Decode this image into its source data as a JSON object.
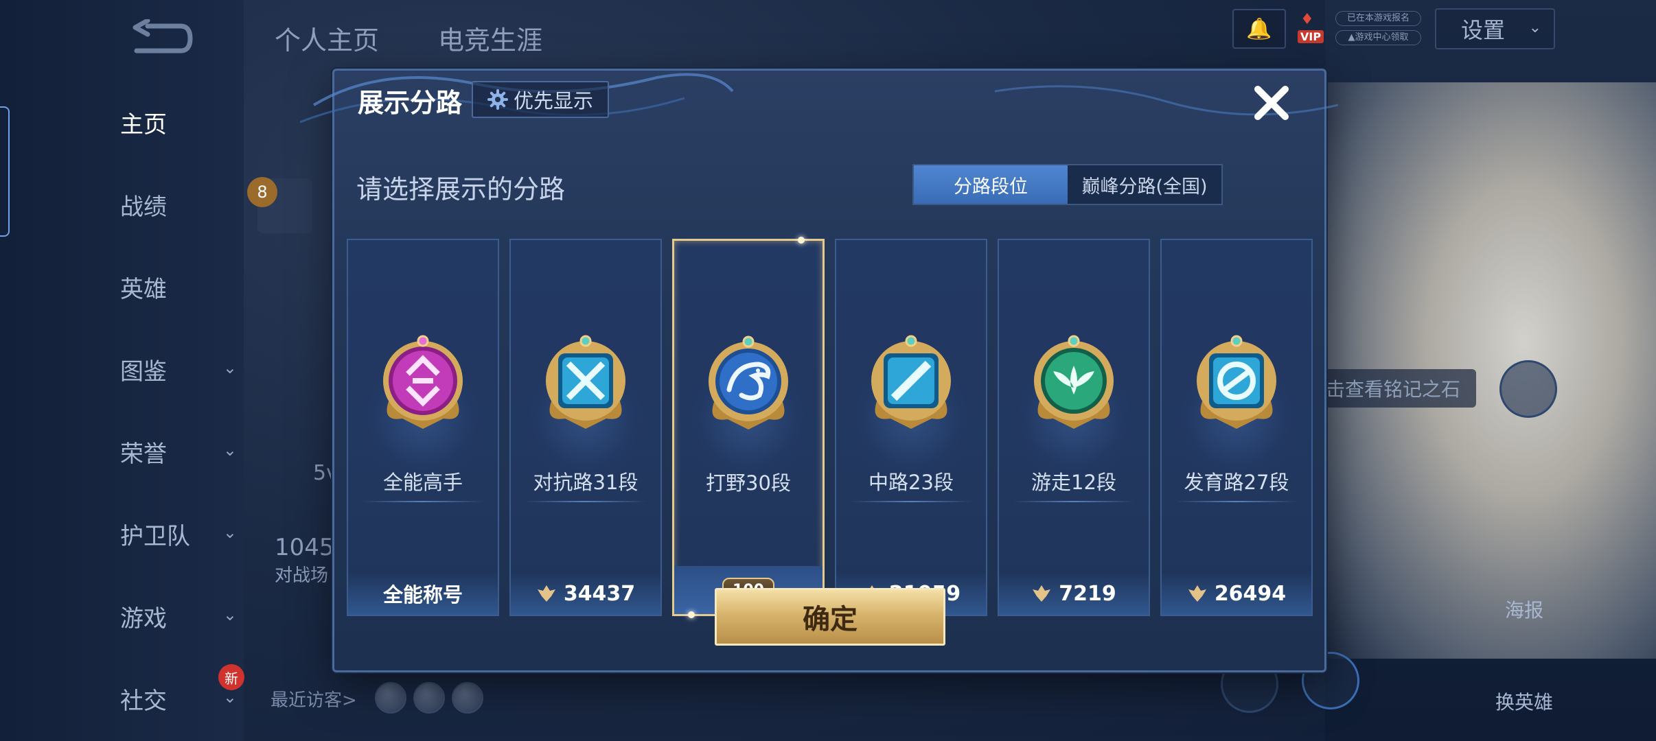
{
  "background": {
    "tabs": [
      "个人主页",
      "电竞生涯"
    ],
    "nav": [
      {
        "label": "主页",
        "active": true
      },
      {
        "label": "战绩"
      },
      {
        "label": "英雄"
      },
      {
        "label": "图鉴",
        "chevron": true
      },
      {
        "label": "荣誉",
        "chevron": true
      },
      {
        "label": "护卫队",
        "chevron": true
      },
      {
        "label": "游戏",
        "chevron": true
      },
      {
        "label": "社交",
        "chevron": true,
        "badge": "新"
      }
    ],
    "settings_label": "设置",
    "vip_label": "VIP",
    "top_pill_1": "已在本游戏报名",
    "top_pill_2": "▲游戏中心领取",
    "level": "8",
    "stats_partial_1": "5v",
    "stats_partial_2": "1045",
    "stats_partial_3": "对战场",
    "hint_text": "点击查看铭记之石",
    "poster_label": "海报",
    "switch_hero_label": "换英雄",
    "visitors_label": "最近访客>"
  },
  "dialog": {
    "title": "展示分路",
    "priority_label": "优先显示",
    "subtitle": "请选择展示的分路",
    "segments": [
      {
        "label": "分路段位",
        "active": true
      },
      {
        "label": "巅峰分路(全国)",
        "active": false
      }
    ],
    "cards": [
      {
        "name": "全能高手",
        "bottom": "全能称号",
        "type": "title",
        "icon": "all-round-badge-icon",
        "color": "#c23bb8"
      },
      {
        "name": "对抗路31段",
        "bottom": "34437",
        "type": "score",
        "icon": "clash-lane-badge-icon",
        "color": "#2fa6d8"
      },
      {
        "name": "打野30段",
        "bottom": "100",
        "type": "rank",
        "icon": "jungle-dragon-badge-icon",
        "color": "#2f6fc8",
        "selected": true
      },
      {
        "name": "中路23段",
        "bottom": "21059",
        "type": "score",
        "icon": "mid-lane-badge-icon",
        "color": "#2fa6d8"
      },
      {
        "name": "游走12段",
        "bottom": "7219",
        "type": "score",
        "icon": "roam-badge-icon",
        "color": "#2aa87c"
      },
      {
        "name": "发育路27段",
        "bottom": "26494",
        "type": "score",
        "icon": "farm-lane-badge-icon",
        "color": "#2fa6d8"
      }
    ],
    "confirm_label": "确定"
  },
  "colors": {
    "accent_blue": "#4f86d1",
    "gold": "#d7b46d",
    "selection_border": "#e6c98c"
  }
}
